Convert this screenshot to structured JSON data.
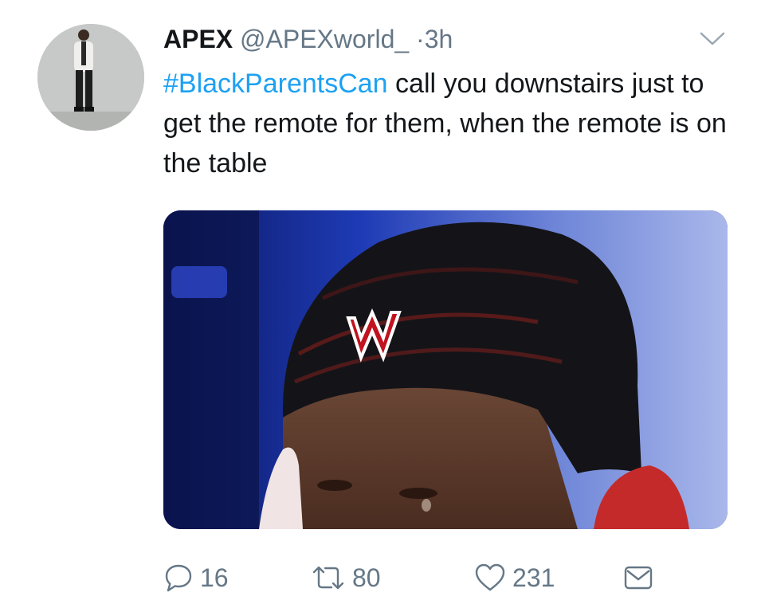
{
  "tweet": {
    "author_name": "APEX",
    "handle": "@APEXworld_",
    "separator": "·",
    "time": "3h",
    "hashtag": "#BlackParentsCan",
    "text": " call you downstairs just to get the remote for them, when the remote is on the table"
  },
  "actions": {
    "reply_count": "16",
    "retweet_count": "80",
    "like_count": "231"
  },
  "icons": {
    "reply": "speech-bubble-icon",
    "retweet": "retweet-arrows-icon",
    "like": "heart-icon",
    "dm": "envelope-icon",
    "menu": "chevron-down-icon"
  },
  "colors": {
    "hashtag": "#1da1f2",
    "secondary_text": "#657786",
    "primary_text": "#14171a"
  }
}
